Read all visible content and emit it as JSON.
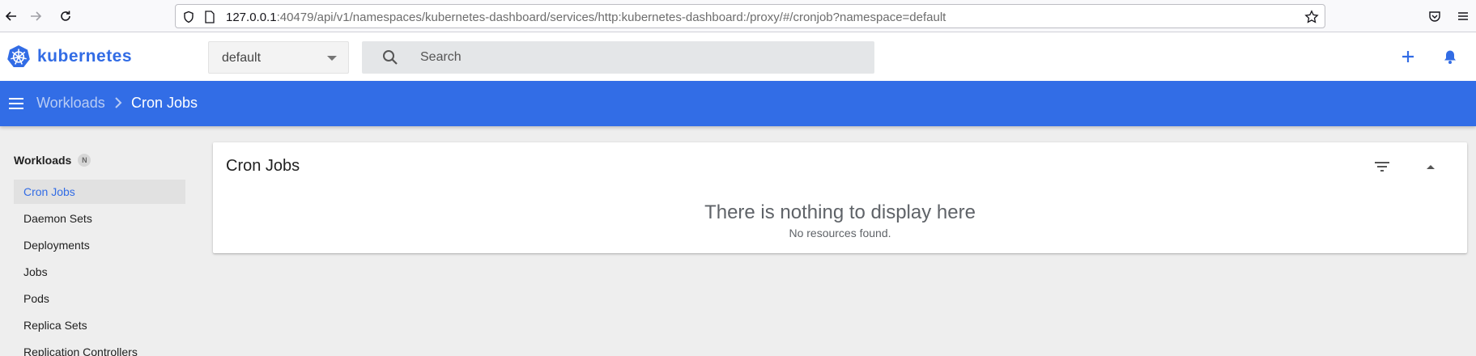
{
  "browser": {
    "url_host": "127.0.0.1",
    "url_rest": ":40479/api/v1/namespaces/kubernetes-dashboard/services/http:kubernetes-dashboard:/proxy/#/cronjob?namespace=default"
  },
  "header": {
    "brand": "kubernetes",
    "namespace": "default",
    "search_placeholder": "Search"
  },
  "breadcrumb": {
    "parent": "Workloads",
    "current": "Cron Jobs"
  },
  "sidebar": {
    "heading": "Workloads",
    "badge": "N",
    "items": [
      {
        "label": "Cron Jobs",
        "active": true
      },
      {
        "label": "Daemon Sets"
      },
      {
        "label": "Deployments"
      },
      {
        "label": "Jobs"
      },
      {
        "label": "Pods"
      },
      {
        "label": "Replica Sets"
      },
      {
        "label": "Replication Controllers"
      }
    ]
  },
  "card": {
    "title": "Cron Jobs",
    "empty_title": "There is nothing to display here",
    "empty_subtitle": "No resources found."
  },
  "colors": {
    "accent": "#326ce5",
    "toolbar": "#326de6",
    "background": "#eeeeee"
  }
}
